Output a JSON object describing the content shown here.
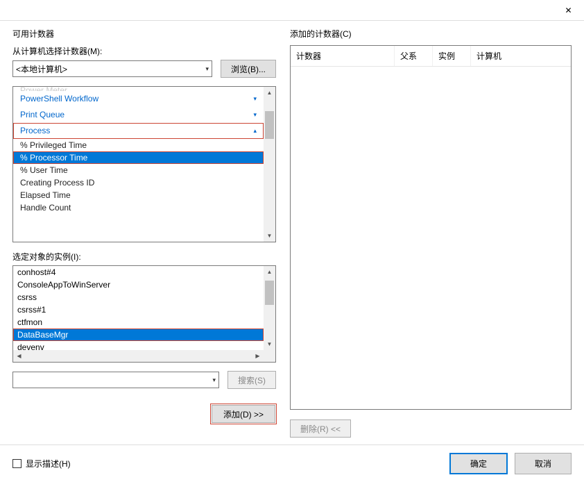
{
  "titlebar": {
    "close_icon": "✕"
  },
  "left": {
    "section_title": "可用计数器",
    "computer_label": "从计算机选择计数器(M):",
    "computer_value": "<本地计算机>",
    "browse_btn": "浏览(B)...",
    "categories_cut": "Power Meter",
    "categories": [
      {
        "name": "PowerShell Workflow",
        "expanded": false
      },
      {
        "name": "Print Queue",
        "expanded": false
      },
      {
        "name": "Process",
        "expanded": true,
        "highlight": true
      }
    ],
    "counters": [
      {
        "name": "% Privileged Time",
        "selected": false
      },
      {
        "name": "% Processor Time",
        "selected": true,
        "highlight": true
      },
      {
        "name": "% User Time",
        "selected": false
      },
      {
        "name": "Creating Process ID",
        "selected": false
      },
      {
        "name": "Elapsed Time",
        "selected": false
      },
      {
        "name": "Handle Count",
        "selected": false
      }
    ],
    "instance_label": "选定对象的实例(I):",
    "instances": [
      {
        "name": "conhost#4",
        "selected": false
      },
      {
        "name": "ConsoleAppToWinServer",
        "selected": false
      },
      {
        "name": "csrss",
        "selected": false
      },
      {
        "name": "csrss#1",
        "selected": false
      },
      {
        "name": "ctfmon",
        "selected": false
      },
      {
        "name": "DataBaseMgr",
        "selected": true,
        "highlight": true
      },
      {
        "name": "devenv",
        "selected": false
      }
    ],
    "search_btn": "搜索(S)",
    "add_btn": "添加(D) >>"
  },
  "right": {
    "section_title": "添加的计数器(C)",
    "columns": {
      "counter": "计数器",
      "parent": "父系",
      "instance": "实例",
      "computer": "计算机"
    },
    "remove_btn": "删除(R) <<"
  },
  "footer": {
    "show_desc": "显示描述(H)",
    "ok": "确定",
    "cancel": "取消"
  }
}
